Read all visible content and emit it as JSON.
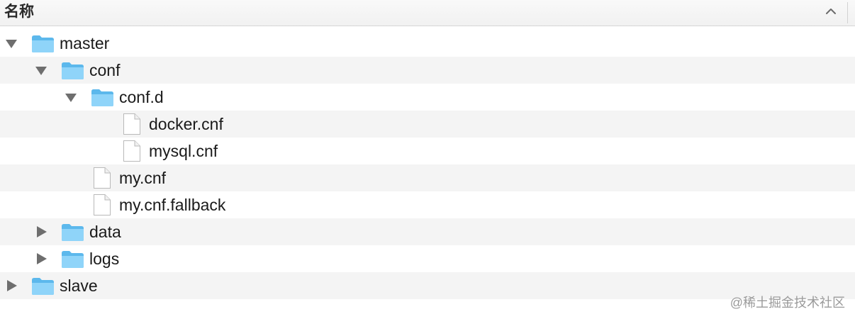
{
  "header": {
    "column_title": "名称",
    "sort_icon": "chevron-up-icon"
  },
  "tree": [
    {
      "name": "master",
      "type": "folder",
      "depth": 0,
      "expanded": true
    },
    {
      "name": "conf",
      "type": "folder",
      "depth": 1,
      "expanded": true
    },
    {
      "name": "conf.d",
      "type": "folder",
      "depth": 2,
      "expanded": true
    },
    {
      "name": "docker.cnf",
      "type": "file",
      "depth": 3
    },
    {
      "name": "mysql.cnf",
      "type": "file",
      "depth": 3
    },
    {
      "name": "my.cnf",
      "type": "file",
      "depth": 2
    },
    {
      "name": "my.cnf.fallback",
      "type": "file",
      "depth": 2
    },
    {
      "name": "data",
      "type": "folder",
      "depth": 1,
      "expanded": false
    },
    {
      "name": "logs",
      "type": "folder",
      "depth": 1,
      "expanded": false
    },
    {
      "name": "slave",
      "type": "folder",
      "depth": 0,
      "expanded": false
    }
  ],
  "watermark": "@稀土掘金技术社区",
  "colors": {
    "folder_light": "#8fd4f9",
    "folder_dark": "#5cb8ec",
    "triangle": "#6e6e6e",
    "row_alt": "#f4f4f4"
  }
}
